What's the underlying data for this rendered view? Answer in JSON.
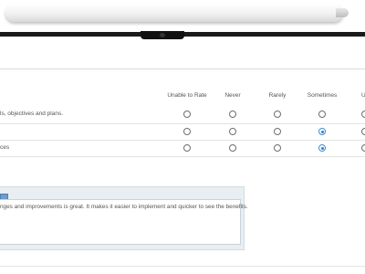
{
  "survey": {
    "columns": [
      "Unable to Rate",
      "Never",
      "Rarely",
      "Sometimes",
      "Us"
    ],
    "rows": [
      {
        "label": "ls, objectives and plans.",
        "selected": null
      },
      {
        "label": "",
        "selected": "Sometimes"
      },
      {
        "label": "ces",
        "selected": "Sometimes"
      }
    ]
  },
  "comment": {
    "text": "nges and improvements is great. It makes it easier to implement and quicker to see the benefits."
  },
  "colors": {
    "radio_selected": "#2b7fd0",
    "comment_panel": "#e8eef2"
  }
}
